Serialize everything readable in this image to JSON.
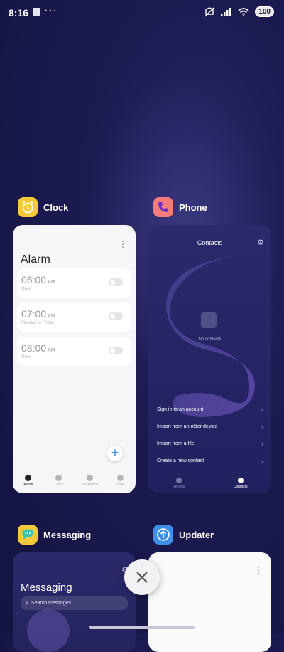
{
  "status_bar": {
    "time": "8:16",
    "more": "···",
    "battery": "100"
  },
  "apps": [
    {
      "name": "Clock",
      "icon": "alarm-clock-icon",
      "icon_color": "#f6c83b",
      "screen": {
        "title": "Alarm",
        "menu": "⋮",
        "alarms": [
          {
            "time": "06:00",
            "period": "AM",
            "repeat": "Once",
            "enabled": false
          },
          {
            "time": "07:00",
            "period": "AM",
            "repeat": "Monday to Friday",
            "enabled": false
          },
          {
            "time": "08:00",
            "period": "AM",
            "repeat": "Once",
            "enabled": false
          }
        ],
        "add_label": "+",
        "nav": [
          "Alarm",
          "Clock",
          "Stopwatch",
          "Timer"
        ],
        "active_nav": "Alarm"
      }
    },
    {
      "name": "Phone",
      "icon": "phone-icon",
      "icon_color": "#f57c7c",
      "screen": {
        "title": "Contacts",
        "empty_text": "No contacts",
        "options": [
          "Sign in to an account",
          "Import from an older device",
          "Import from a file",
          "Create a new contact"
        ],
        "nav": [
          "Recents",
          "Contacts"
        ],
        "active_nav": "Contacts"
      }
    },
    {
      "name": "Messaging",
      "icon": "chat-bubble-icon",
      "icon_color": "#f6c83b",
      "screen": {
        "title": "Messaging",
        "search_placeholder": "Search messages"
      }
    },
    {
      "name": "Updater",
      "icon": "upload-arrow-icon",
      "icon_color": "#3f8fe8",
      "screen": {
        "menu": "⋮"
      }
    }
  ],
  "close_all_label": "×"
}
